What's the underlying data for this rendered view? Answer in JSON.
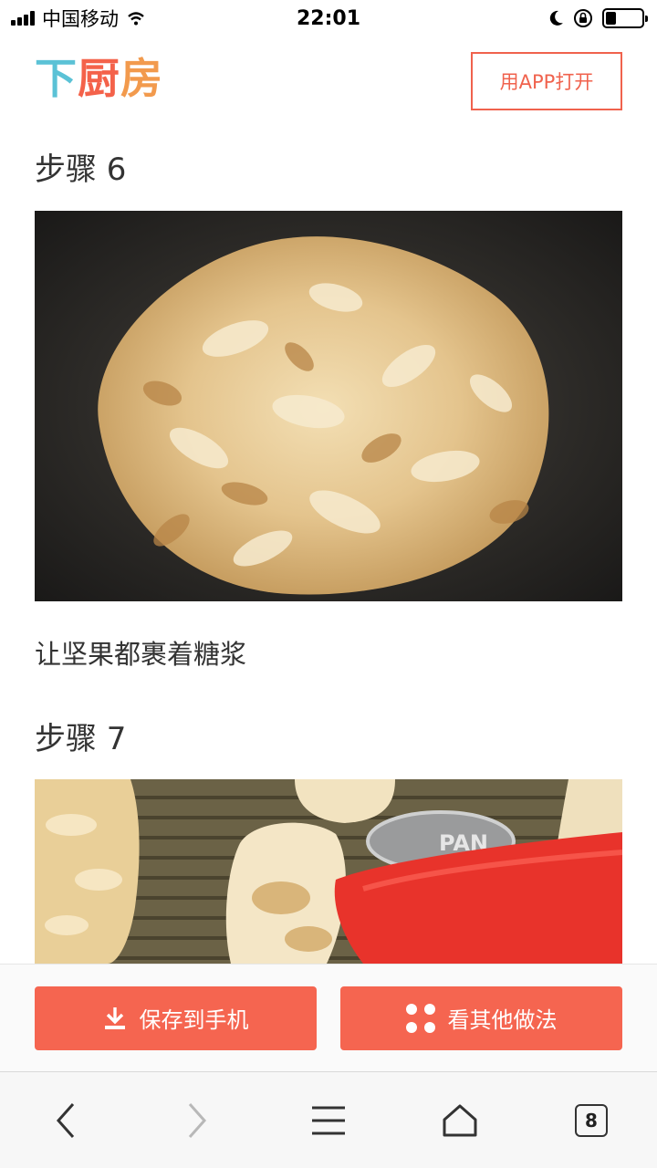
{
  "status_bar": {
    "carrier": "中国移动",
    "time": "22:01"
  },
  "header": {
    "logo": [
      "下",
      "厨",
      "房"
    ],
    "open_app_label": "用APP打开"
  },
  "steps": [
    {
      "title": "步骤 6",
      "description": "让坚果都裹着糖浆",
      "image_alt": "caramel coated nuts in a dark pot"
    },
    {
      "title": "步骤 7",
      "description": "",
      "image_alt": "filling tart shells on a baking tray with a red spatula",
      "image_text": "PAN"
    }
  ],
  "actions": {
    "save_label": "保存到手机",
    "other_label": "看其他做法"
  },
  "browser": {
    "tab_count": "8"
  },
  "colors": {
    "accent": "#f56550",
    "logo_blue": "#5bc2d6",
    "logo_red": "#f4624a",
    "logo_orange": "#f29a4d"
  }
}
